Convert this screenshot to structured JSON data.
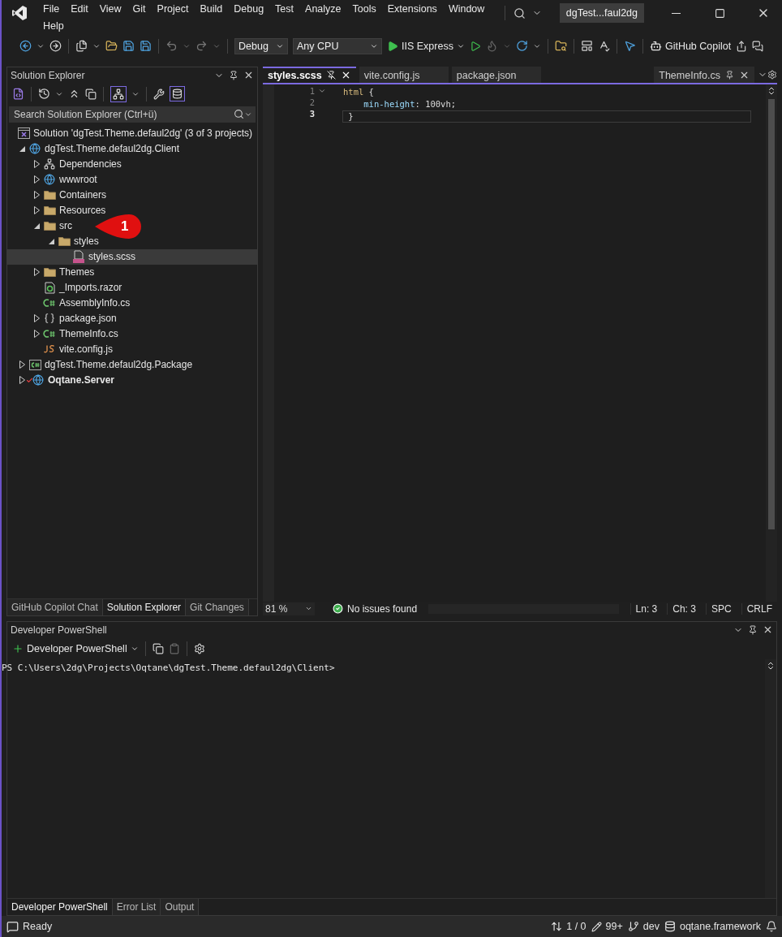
{
  "menu": [
    "File",
    "Edit",
    "View",
    "Git",
    "Project",
    "Build",
    "Debug",
    "Test",
    "Analyze",
    "Tools",
    "Extensions",
    "Window",
    "Help"
  ],
  "window": {
    "title": "dgTest...faul2dg"
  },
  "toolbar": {
    "configuration": "Debug",
    "platform": "Any CPU",
    "run_target": "IIS Express",
    "copilot": "GitHub Copilot"
  },
  "solution_explorer": {
    "title": "Solution Explorer",
    "search": {
      "placeholder": "Search Solution Explorer (Ctrl+ü)"
    },
    "solution": {
      "label": "Solution 'dgTest.Theme.defaul2dg' (3 of 3 projects)",
      "children": [
        {
          "label": "dgTest.Theme.defaul2dg.Client",
          "kind": "project",
          "expanded": true,
          "selected": false,
          "bold": false,
          "check_mark": false,
          "children": [
            {
              "label": "Dependencies",
              "kind": "dependencies",
              "expanded": false,
              "selected": false,
              "bold": false
            },
            {
              "label": "wwwroot",
              "kind": "globe",
              "expanded": false,
              "selected": false,
              "bold": false
            },
            {
              "label": "Containers",
              "kind": "folder",
              "expanded": false,
              "selected": false,
              "bold": false
            },
            {
              "label": "Resources",
              "kind": "folder",
              "expanded": false,
              "selected": false,
              "bold": false
            },
            {
              "label": "src",
              "kind": "folder",
              "expanded": true,
              "selected": false,
              "bold": false,
              "callout": "1",
              "children": [
                {
                  "label": "styles",
                  "kind": "folder",
                  "expanded": true,
                  "selected": false,
                  "bold": false,
                  "children": [
                    {
                      "label": "styles.scss",
                      "kind": "sass",
                      "selected": true,
                      "bold": false
                    }
                  ]
                }
              ]
            },
            {
              "label": "Themes",
              "kind": "folder",
              "expanded": false,
              "selected": false,
              "bold": false
            },
            {
              "label": "_Imports.razor",
              "kind": "razor",
              "selected": false,
              "bold": false
            },
            {
              "label": "AssemblyInfo.cs",
              "kind": "csharp",
              "selected": false,
              "bold": false
            },
            {
              "label": "package.json",
              "kind": "json",
              "expanded": false,
              "selected": false,
              "bold": false
            },
            {
              "label": "ThemeInfo.cs",
              "kind": "csharp",
              "expanded": false,
              "selected": false,
              "bold": false
            },
            {
              "label": "vite.config.js",
              "kind": "js",
              "selected": false,
              "bold": false
            }
          ]
        },
        {
          "label": "dgTest.Theme.defaul2dg.Package",
          "kind": "csproj",
          "expanded": false,
          "selected": false,
          "bold": false,
          "check_mark": false
        },
        {
          "label": "Oqtane.Server",
          "kind": "project",
          "expanded": false,
          "selected": false,
          "bold": true,
          "check_mark": true
        }
      ]
    },
    "tabs": [
      {
        "label": "GitHub Copilot Chat",
        "selected": false
      },
      {
        "label": "Solution Explorer",
        "selected": true
      },
      {
        "label": "Git Changes",
        "selected": false
      }
    ]
  },
  "editor": {
    "tabs": [
      {
        "label": "styles.scss",
        "selected": true,
        "pinned": false
      },
      {
        "label": "vite.config.js",
        "selected": false,
        "pinned": false
      },
      {
        "label": "package.json",
        "selected": false,
        "pinned": false
      }
    ],
    "right_tabs": [
      {
        "label": "ThemeInfo.cs",
        "selected": false,
        "pinned": true
      }
    ],
    "lines": [
      {
        "number": "1",
        "current": false,
        "tokens": [
          {
            "text": "html",
            "kind": "selector"
          },
          {
            "text": " {",
            "kind": "punct"
          }
        ]
      },
      {
        "number": "2",
        "current": false,
        "tokens": [
          {
            "text": "    min-height",
            "kind": "property"
          },
          {
            "text": ": 100vh;",
            "kind": "value"
          }
        ]
      },
      {
        "number": "3",
        "current": true,
        "tokens": [
          {
            "text": " }",
            "kind": "punct"
          }
        ]
      }
    ],
    "status": {
      "zoom": "81 %",
      "issues": "No issues found",
      "line": "Ln: 3",
      "column": "Ch: 3",
      "whitespace": "SPC",
      "line_endings": "CRLF"
    }
  },
  "terminal": {
    "title": "Developer PowerShell",
    "profile": "Developer PowerShell",
    "prompt": "PS C:\\Users\\2dg\\Projects\\Oqtane\\dgTest.Theme.defaul2dg\\Client>",
    "tabs": [
      {
        "label": "Developer PowerShell",
        "selected": true
      },
      {
        "label": "Error List",
        "selected": false
      },
      {
        "label": "Output",
        "selected": false
      }
    ]
  },
  "status_bar": {
    "state": "Ready",
    "commits": "1 / 0",
    "changes": "99+",
    "branch": "dev",
    "repository": "oqtane.framework"
  }
}
